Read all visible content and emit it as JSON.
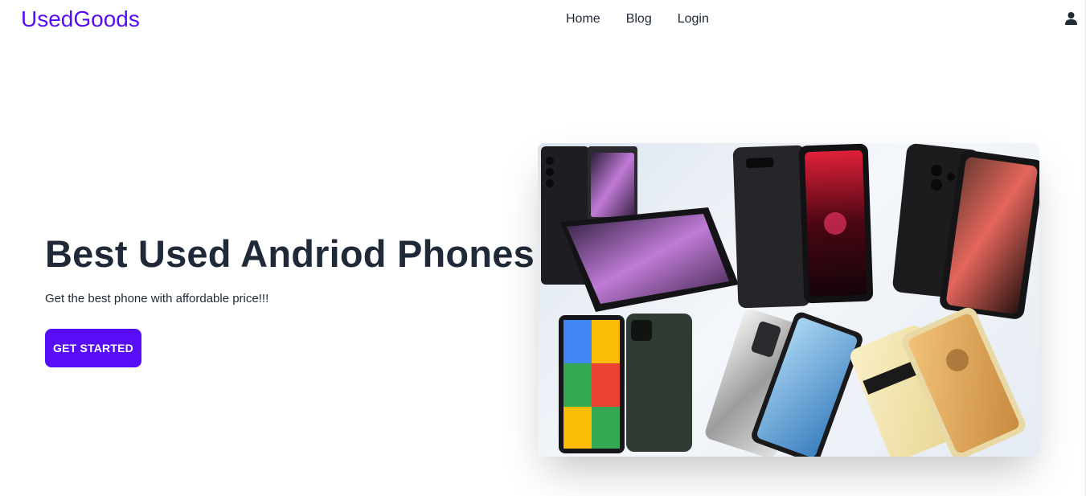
{
  "navbar": {
    "logo": "UsedGoods",
    "links": [
      "Home",
      "Blog",
      "Login"
    ],
    "profile_icon": "user-icon"
  },
  "hero": {
    "title": "Best Used Andriod Phones",
    "subtitle": "Get the best phone with affordable price!!!",
    "cta_label": "GET STARTED"
  },
  "colors": {
    "primary": "#570df8",
    "text": "#1f2937",
    "background": "#ffffff"
  }
}
